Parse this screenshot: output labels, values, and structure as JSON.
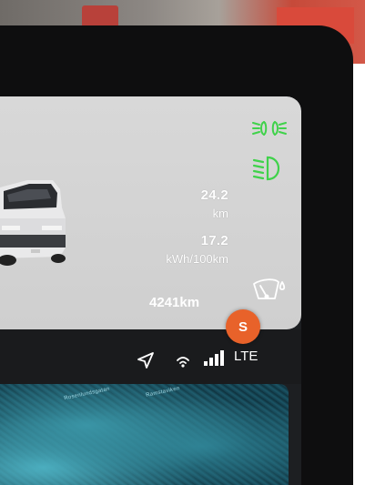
{
  "driver_info": {
    "trip_distance_value": "24.2",
    "trip_distance_unit": "km",
    "energy_consumption_value": "17.2",
    "energy_consumption_unit": "kWh/100km",
    "odometer": "4241km"
  },
  "telltales": {
    "parking_lights_color": "#3fd24a",
    "low_beam_color": "#3fd24a",
    "wiper_color": "#ffffff"
  },
  "status_bar": {
    "network": "LTE",
    "icons": [
      "navigation-arrow-icon",
      "wifi-icon",
      "signal-bars-icon"
    ]
  },
  "map": {
    "labels": [
      "Rosenlundsgatan",
      "Ramstaviken"
    ]
  },
  "profile": {
    "initial": "S",
    "color": "#e8622a"
  }
}
